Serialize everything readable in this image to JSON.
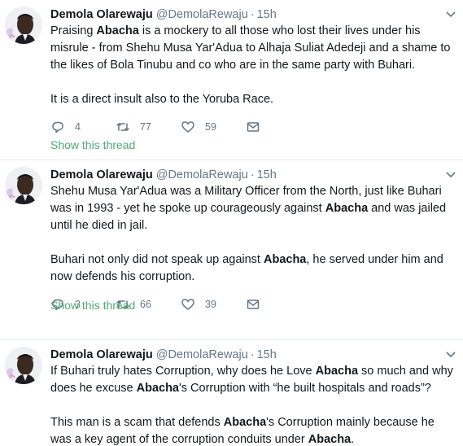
{
  "tweets": [
    {
      "name": "Demola Olarewaju",
      "handle": "@DemolaRewaju",
      "time": "15h",
      "paragraphs": [
        [
          {
            "t": "Praising "
          },
          {
            "t": "Abacha",
            "b": true
          },
          {
            "t": " is a mockery to all those who lost their lives under his misrule - from Shehu Musa Yar'Adua to Alhaja Suliat Adedeji and a shame to the likes of Bola Tinubu and co who are in the same party with Buhari."
          }
        ],
        [
          {
            "t": "It is a direct insult also to the Yoruba Race."
          }
        ]
      ],
      "replies": "4",
      "retweets": "77",
      "likes": "59",
      "show_thread": "Show this thread"
    },
    {
      "name": "Demola Olarewaju",
      "handle": "@DemolaRewaju",
      "time": "15h",
      "paragraphs": [
        [
          {
            "t": "Shehu Musa Yar'Adua was a Military Officer from the North, just like Buhari was in 1993 - yet he spoke up courageously against "
          },
          {
            "t": "Abacha",
            "b": true
          },
          {
            "t": " and was jailed until he died in jail."
          }
        ],
        [
          {
            "t": "Buhari not only did not speak up against "
          },
          {
            "t": "Abacha",
            "b": true
          },
          {
            "t": ", he served under him and now defends his corruption."
          }
        ]
      ],
      "replies": "3",
      "retweets": "66",
      "likes": "39",
      "show_thread": "Show this thread"
    },
    {
      "name": "Demola Olarewaju",
      "handle": "@DemolaRewaju",
      "time": "15h",
      "paragraphs": [
        [
          {
            "t": "If Buhari truly hates Corruption, why does he Love "
          },
          {
            "t": "Abacha",
            "b": true
          },
          {
            "t": " so much and why does he excuse "
          },
          {
            "t": "Abacha",
            "b": true
          },
          {
            "t": "'s Corruption with “he built hospitals and roads”?"
          }
        ],
        [
          {
            "t": "This man is a scam that defends "
          },
          {
            "t": "Abacha",
            "b": true
          },
          {
            "t": "'s Corruption mainly because he was a key agent of the corruption conduits under "
          },
          {
            "t": "Abacha",
            "b": true
          },
          {
            "t": "."
          }
        ]
      ]
    }
  ],
  "dot": "·",
  "icons": {
    "reply": "reply-icon",
    "retweet": "retweet-icon",
    "like": "heart-icon",
    "dm": "envelope-icon",
    "caret": "chevron-down-icon"
  },
  "colors": {
    "thread_link": "#4ea87a",
    "secondary": "#657786"
  }
}
